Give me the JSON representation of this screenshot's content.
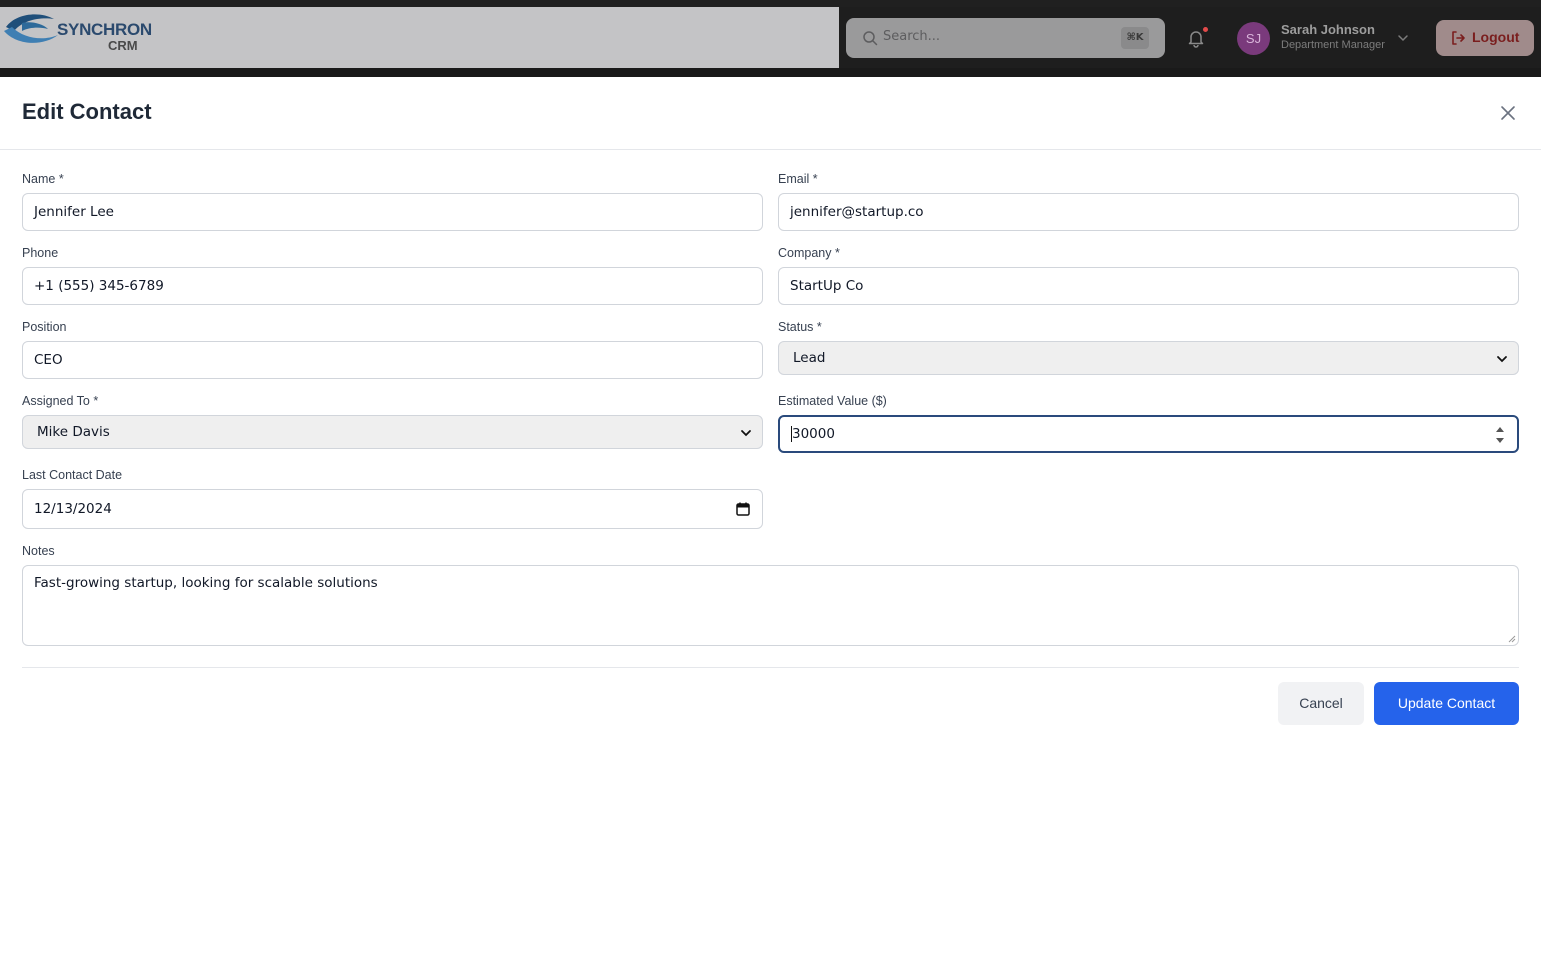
{
  "header": {
    "brand_name": "SYNCHRON",
    "brand_sub": "CRM",
    "search_placeholder": "Search...",
    "search_shortcut": "⌘K",
    "user_initials": "SJ",
    "user_name": "Sarah Johnson",
    "user_role": "Department Manager",
    "logout_label": "Logout",
    "icons": [
      "search-icon",
      "bell-icon",
      "chevron-down-icon",
      "logout-icon"
    ]
  },
  "modal": {
    "title": "Edit Contact",
    "fields": {
      "name": {
        "label": "Name *",
        "value": "Jennifer Lee"
      },
      "email": {
        "label": "Email *",
        "value": "jennifer@startup.co"
      },
      "phone": {
        "label": "Phone",
        "value": "+1 (555) 345-6789"
      },
      "company": {
        "label": "Company *",
        "value": "StartUp Co"
      },
      "position": {
        "label": "Position",
        "value": "CEO"
      },
      "status": {
        "label": "Status *",
        "value": "Lead"
      },
      "assigned_to": {
        "label": "Assigned To *",
        "value": "Mike Davis"
      },
      "estimated_value": {
        "label": "Estimated Value ($)",
        "value": "30000"
      },
      "last_contact_date": {
        "label": "Last Contact Date",
        "value": "12/13/2024"
      },
      "notes": {
        "label": "Notes",
        "value": "Fast-growing startup, looking for scalable solutions"
      }
    },
    "cancel_label": "Cancel",
    "submit_label": "Update Contact"
  },
  "colors": {
    "primary": "#2563eb",
    "logout_text": "#7a1e1e",
    "focus_border": "#2a4a7c"
  }
}
